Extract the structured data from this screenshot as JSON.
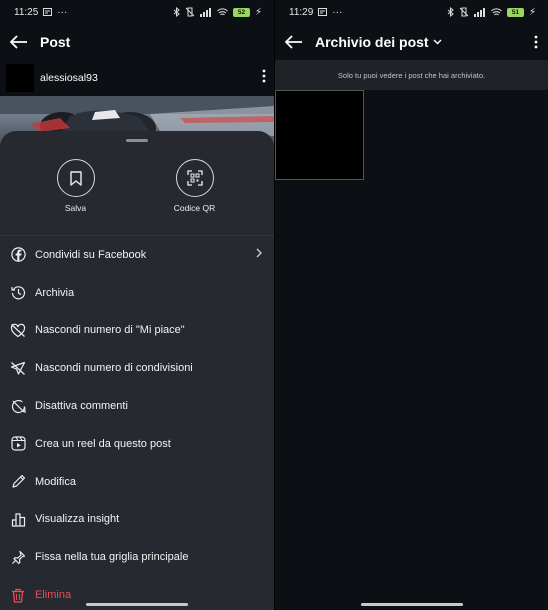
{
  "left": {
    "status": {
      "time": "11:25",
      "battery": "52"
    },
    "appbar": {
      "title": "Post"
    },
    "post": {
      "username": "alessiosal93"
    },
    "sheet": {
      "quick_actions": [
        {
          "label": "Salva",
          "icon": "bookmark-icon"
        },
        {
          "label": "Codice QR",
          "icon": "qr-code-icon"
        }
      ],
      "menu": [
        {
          "label": "Condividi su Facebook",
          "icon": "facebook-icon",
          "chevron": true
        },
        {
          "label": "Archivia",
          "icon": "archive-icon"
        },
        {
          "label": "Nascondi numero di \"Mi piace\"",
          "icon": "heart-off-icon"
        },
        {
          "label": "Nascondi numero di condivisioni",
          "icon": "share-off-icon"
        },
        {
          "label": "Disattiva commenti",
          "icon": "comment-off-icon"
        },
        {
          "label": "Crea un reel da questo post",
          "icon": "reel-icon"
        },
        {
          "label": "Modifica",
          "icon": "pencil-icon"
        },
        {
          "label": "Visualizza insight",
          "icon": "chart-icon"
        },
        {
          "label": "Fissa nella tua griglia principale",
          "icon": "pin-icon"
        },
        {
          "label": "Elimina",
          "icon": "trash-icon",
          "danger": true
        }
      ]
    }
  },
  "right": {
    "status": {
      "time": "11:29",
      "battery": "51"
    },
    "appbar": {
      "title": "Archivio dei post"
    },
    "info": "Solo tu puoi vedere i post che hai archiviato."
  },
  "colors": {
    "background": "#0c0f14",
    "sheet": "#262a30",
    "danger": "#ed4956",
    "battery": "#9bd65c"
  }
}
